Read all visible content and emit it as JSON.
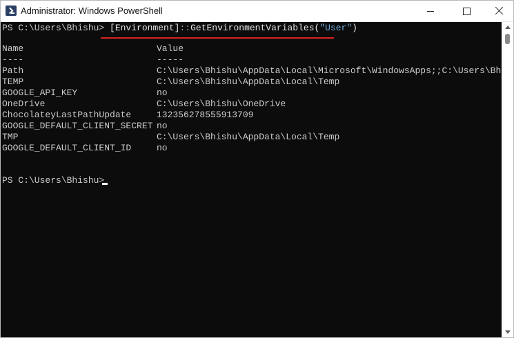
{
  "window": {
    "title": "Administrator: Windows PowerShell"
  },
  "console": {
    "command": {
      "prompt": "PS C:\\Users\\Bhishu> ",
      "class_token": "[Environment]",
      "sep": "::",
      "method": "GetEnvironmentVariables(",
      "arg": "\"User\"",
      "close": ")"
    },
    "headers": {
      "name": "Name",
      "value": "Value",
      "name_rule": "----",
      "value_rule": "-----"
    },
    "rows": [
      {
        "name": "Path",
        "value": "C:\\Users\\Bhishu\\AppData\\Local\\Microsoft\\WindowsApps;;C:\\Users\\Bhi..."
      },
      {
        "name": "TEMP",
        "value": "C:\\Users\\Bhishu\\AppData\\Local\\Temp"
      },
      {
        "name": "GOOGLE_API_KEY",
        "value": "no"
      },
      {
        "name": "OneDrive",
        "value": "C:\\Users\\Bhishu\\OneDrive"
      },
      {
        "name": "ChocolateyLastPathUpdate",
        "value": "132356278555913709"
      },
      {
        "name": "GOOGLE_DEFAULT_CLIENT_SECRET",
        "value": "no"
      },
      {
        "name": "TMP",
        "value": "C:\\Users\\Bhishu\\AppData\\Local\\Temp"
      },
      {
        "name": "GOOGLE_DEFAULT_CLIENT_ID",
        "value": "no"
      }
    ],
    "final_prompt": "PS C:\\Users\\Bhishu>"
  },
  "icons": [
    "powershell-icon",
    "minimize-icon",
    "maximize-icon",
    "close-icon",
    "scroll-up-icon",
    "scroll-down-icon"
  ],
  "colors": {
    "background": "#0c0c0c",
    "text": "#cccccc",
    "string": "#6fa8dc",
    "annotation_underline": "#d92323"
  }
}
